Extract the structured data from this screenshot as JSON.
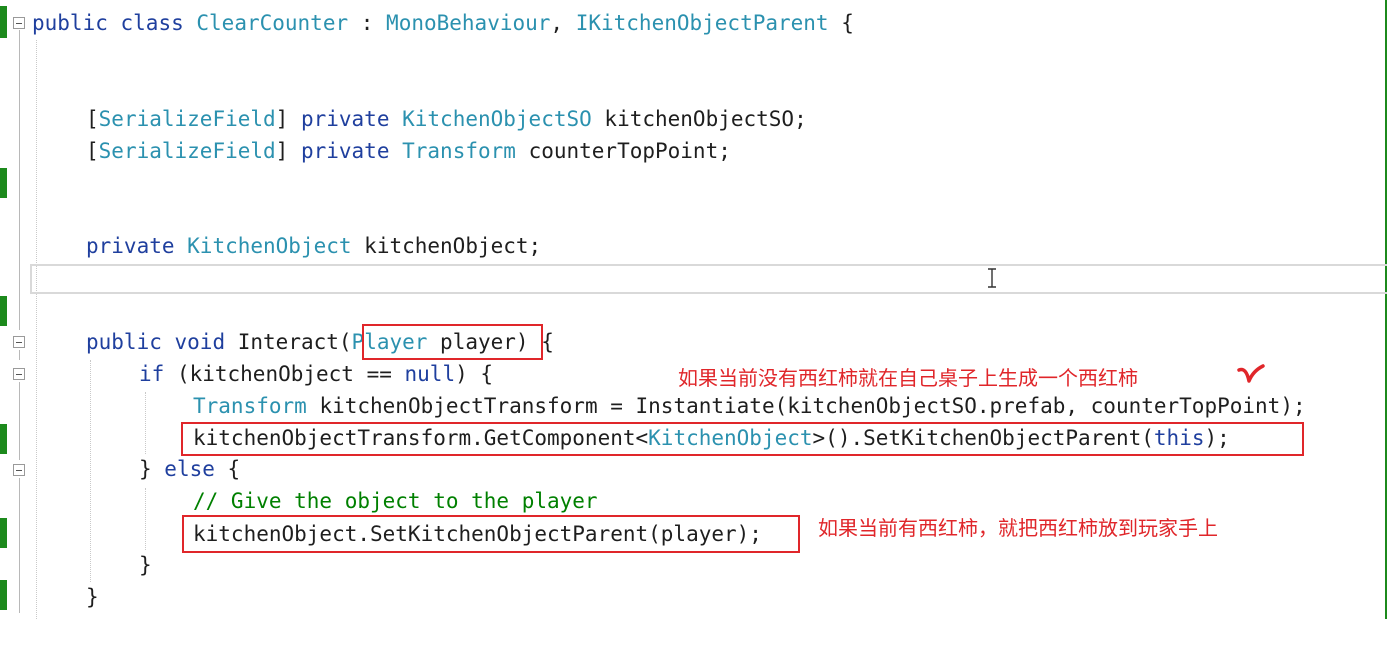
{
  "code": {
    "class_decl": {
      "kw_public": "public",
      "kw_class": "class",
      "name": "ClearCounter",
      "colon": " : ",
      "base1": "MonoBehaviour",
      "comma": ", ",
      "base2": "IKitchenObjectParent",
      "brace": " {"
    },
    "field1": {
      "open": "[",
      "attr": "SerializeField",
      "close": "]",
      "kw": " private ",
      "type": "KitchenObjectSO",
      "rest": " kitchenObjectSO;"
    },
    "field2": {
      "open": "[",
      "attr": "SerializeField",
      "close": "]",
      "kw": " private ",
      "type": "Transform",
      "rest": " counterTopPoint;"
    },
    "field3": {
      "kw": "private ",
      "type": "KitchenObject",
      "rest": " kitchenObject;"
    },
    "method": {
      "kw_public": "public",
      "kw_void": "void",
      "name": "Interact(",
      "param_type": "Player",
      "param_name": " player",
      "close": ") {"
    },
    "if_line": {
      "kw_if": "if",
      "cond": " (kitchenObject == ",
      "kw_null": "null",
      "close": ") {"
    },
    "instantiate_line": {
      "type": "Transform",
      "rest": " kitchenObjectTransform = Instantiate(kitchenObjectSO.prefab, counterTopPoint);"
    },
    "getcomponent_line": {
      "pre": "kitchenObjectTransform.GetComponent<",
      "type": "KitchenObject",
      "mid": ">().SetKitchenObjectParent(",
      "kw_this": "this",
      "end": ");"
    },
    "else_line": {
      "pre": "} ",
      "kw_else": "else",
      "post": " {"
    },
    "comment_line": "// Give the object to the player",
    "setparent_line": "kitchenObject.SetKitchenObjectParent(player);",
    "close_if": "}",
    "close_method": "}"
  },
  "annotations": {
    "note1": "如果当前没有西红柿就在自己桌子上生成一个西红柿",
    "note2": "如果当前有西红柿，就把西红柿放到玩家手上"
  },
  "colors": {
    "keyword": "#1f3f9e",
    "type": "#2b91af",
    "comment": "#008000",
    "annotation": "#e0262a",
    "gutter_change": "#1c8a1c"
  }
}
